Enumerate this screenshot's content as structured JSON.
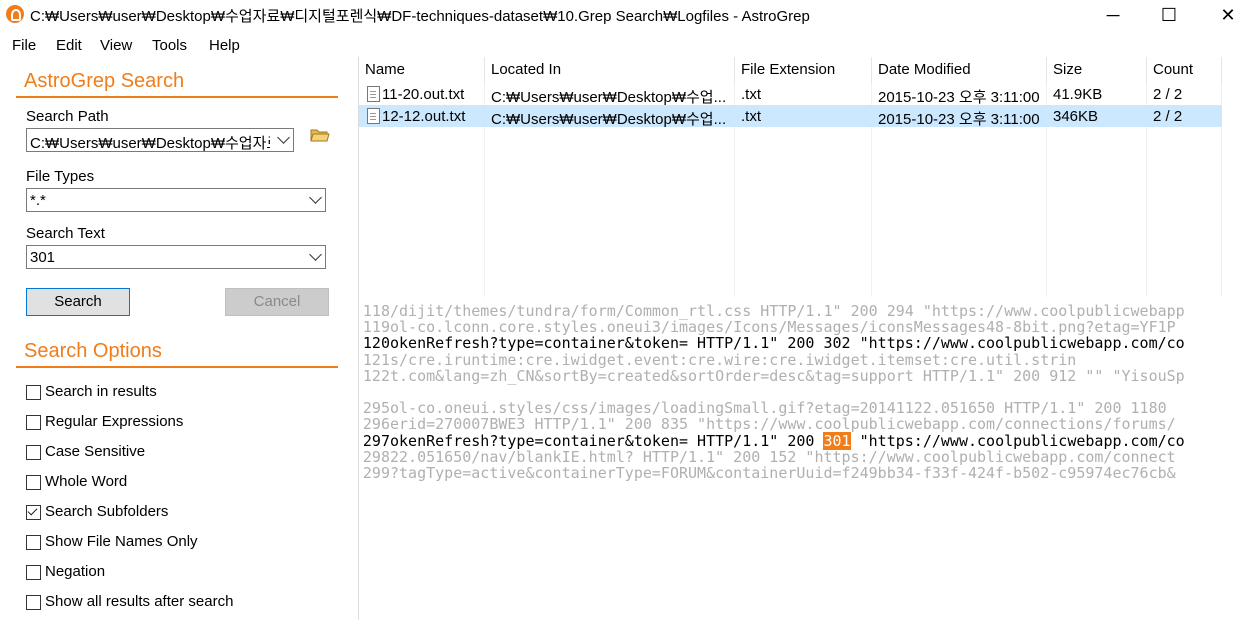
{
  "window": {
    "title": "C:₩Users₩user₩Desktop₩수업자료₩디지털포렌식₩DF-techniques-dataset₩10.Grep Search₩Logfiles - AstroGrep",
    "minimize": "─",
    "maximize": "☐",
    "close": "✕"
  },
  "menu": [
    "File",
    "Edit",
    "View",
    "Tools",
    "Help"
  ],
  "search": {
    "title": "AstroGrep Search",
    "path_label": "Search Path",
    "path_value": "C:₩Users₩user₩Desktop₩수업자료",
    "types_label": "File Types",
    "types_value": "*.*",
    "text_label": "Search Text",
    "text_value": "301",
    "search_button": "Search",
    "cancel_button": "Cancel"
  },
  "options": {
    "title": "Search Options",
    "items": [
      {
        "label": "Search in results",
        "checked": false
      },
      {
        "label": "Regular Expressions",
        "checked": false
      },
      {
        "label": "Case Sensitive",
        "checked": false
      },
      {
        "label": "Whole Word",
        "checked": false
      },
      {
        "label": "Search Subfolders",
        "checked": true
      },
      {
        "label": "Show File Names Only",
        "checked": false
      },
      {
        "label": "Negation",
        "checked": false
      },
      {
        "label": "Show all results after search",
        "checked": false
      }
    ]
  },
  "results": {
    "columns": [
      "Name",
      "Located In",
      "File Extension",
      "Date Modified",
      "Size",
      "Count"
    ],
    "rows": [
      {
        "name": "11-20.out.txt",
        "location": "C:₩Users₩user₩Desktop₩수업...",
        "ext": ".txt",
        "date": "2015-10-23 오후 3:11:00",
        "size": "41.9KB",
        "count": "2 / 2",
        "selected": false
      },
      {
        "name": "12-12.out.txt",
        "location": "C:₩Users₩user₩Desktop₩수업...",
        "ext": ".txt",
        "date": "2015-10-23 오후 3:11:00",
        "size": "346KB",
        "count": "2 / 2",
        "selected": true
      }
    ]
  },
  "preview": {
    "lines": [
      {
        "num": "118",
        "text": "/dijit/themes/tundra/form/Common_rtl.css HTTP/1.1\" 200 294 \"https://www.coolpublicwebapp",
        "kind": "ctx"
      },
      {
        "num": "119",
        "text": "ol-co.lconn.core.styles.oneui3/images/Icons/Messages/iconsMessages48-8bit.png?etag=YF1P",
        "kind": "ctx"
      },
      {
        "num": "120",
        "text": "okenRefresh?type=container&token= HTTP/1.1\" 200 302 \"https://www.coolpublicwebapp.com/co",
        "kind": "hit"
      },
      {
        "num": "121",
        "text": "s/cre.iruntime:cre.iwidget.event:cre.wire:cre.iwidget.itemset:cre.util.strin",
        "kind": "ctx"
      },
      {
        "num": "122",
        "text": "t.com&lang=zh_CN&sortBy=created&sortOrder=desc&tag=support HTTP/1.1\" 200 912 \"\" \"YisouSp",
        "kind": "ctx"
      },
      {
        "num": "",
        "text": "",
        "kind": "ctx"
      },
      {
        "num": "295",
        "text": "ol-co.oneui.styles/css/images/loadingSmall.gif?etag=20141122.051650 HTTP/1.1\" 200 1180",
        "kind": "ctx"
      },
      {
        "num": "296",
        "text": "erid=270007BWE3 HTTP/1.1\" 200 835 \"https://www.coolpublicwebapp.com/connections/forums/",
        "kind": "ctx"
      },
      {
        "num": "297",
        "text_before": "okenRefresh?type=container&token= HTTP/1.1\" 200 ",
        "match": "301",
        "text_after": " \"https://www.coolpublicwebapp.com/co",
        "kind": "match"
      },
      {
        "num": "298",
        "text": "22.051650/nav/blankIE.html? HTTP/1.1\" 200 152 \"https://www.coolpublicwebapp.com/connect",
        "kind": "ctx"
      },
      {
        "num": "299",
        "text": "?tagType=active&containerType=FORUM&containerUuid=f249bb34-f33f-424f-b502-c95974ec76cb&",
        "kind": "ctx"
      }
    ],
    "highlight_color": "#f07d1a"
  }
}
